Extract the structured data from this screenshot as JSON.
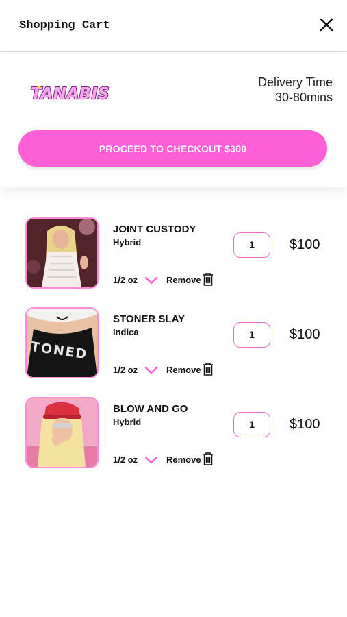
{
  "header": {
    "title": "Shopping Cart"
  },
  "store": {
    "logo_text": "TANABIS",
    "delivery_label": "Delivery Time",
    "delivery_value": "30-80mins"
  },
  "checkout": {
    "label": "PROCEED TO CHECKOUT $300"
  },
  "colors": {
    "accent": "#ff5fd6",
    "border_pink": "#f06ac9"
  },
  "cart": {
    "items": [
      {
        "name": "JOINT CUSTODY",
        "type": "Hybrid",
        "size": "1/2 oz",
        "qty": "1",
        "price": "$100",
        "remove": "Remove"
      },
      {
        "name": "STONER SLAY",
        "type": "Indica",
        "size": "1/2 oz",
        "qty": "1",
        "price": "$100",
        "remove": "Remove",
        "image_text": "TONED"
      },
      {
        "name": "BLOW AND GO",
        "type": "Hybrid",
        "size": "1/2 oz",
        "qty": "1",
        "price": "$100",
        "remove": "Remove"
      }
    ]
  }
}
